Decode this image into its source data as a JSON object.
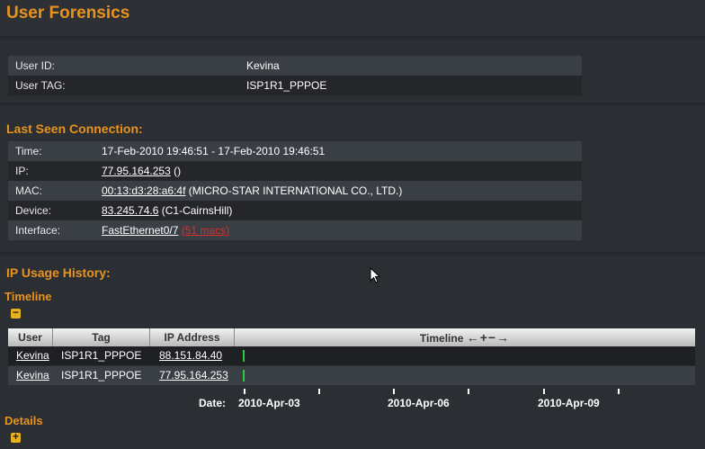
{
  "page": {
    "title": "User Forensics"
  },
  "user_info": [
    {
      "key": "User ID:",
      "value": "Kevina"
    },
    {
      "key": "User TAG:",
      "value": "ISP1R1_PPPOE"
    }
  ],
  "last_seen": {
    "title": "Last Seen Connection:",
    "time": {
      "key": "Time:",
      "value": "17-Feb-2010 19:46:51 - 17-Feb-2010 19:46:51"
    },
    "ip": {
      "key": "IP:",
      "link": "77.95.164.253",
      "suffix": " ()"
    },
    "mac": {
      "key": "MAC:",
      "link": "00:13:d3:28:a6:4f",
      "suffix": " (MICRO-STAR INTERNATIONAL CO., LTD.)"
    },
    "device": {
      "key": "Device:",
      "link": "83.245.74.6",
      "suffix": " (C1-CairnsHill)"
    },
    "interface": {
      "key": "Interface:",
      "link": "FastEthernet0/7",
      "extra_link": "(51 macs)"
    }
  },
  "ip_history": {
    "title": "IP Usage History:",
    "timeline_label": "Timeline",
    "details_label": "Details",
    "columns": {
      "user": "User",
      "tag": "Tag",
      "ip": "IP Address",
      "timeline": "Timeline",
      "nav": "←+−→"
    },
    "rows": [
      {
        "user": "Kevina",
        "tag": "ISP1R1_PPPOE",
        "ip": "88.151.84.40"
      },
      {
        "user": "Kevina",
        "tag": "ISP1R1_PPPOE",
        "ip": "77.95.164.253"
      }
    ],
    "date_label": "Date:",
    "dates": [
      "2010-Apr-03",
      "2010-Apr-06",
      "2010-Apr-09"
    ]
  },
  "colors": {
    "accent": "#e8931e",
    "bar": "#2ecc40",
    "link_red": "#d93030"
  },
  "icons": {
    "collapse": "minus-square-icon",
    "expand": "plus-square-icon",
    "cursor": "mouse-pointer-icon"
  }
}
